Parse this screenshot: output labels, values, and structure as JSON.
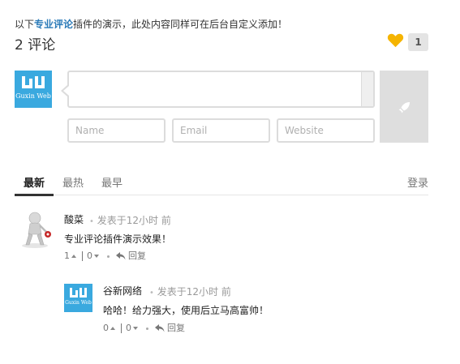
{
  "intro": {
    "prefix": "以下",
    "highlight": "专业评论",
    "suffix": "插件的演示，此处内容同样可在后台自定义添加！"
  },
  "comment_count": "2 评论",
  "like_count": "1",
  "logo_text": "Guxin Web",
  "form": {
    "name_placeholder": "Name",
    "email_placeholder": "Email",
    "website_placeholder": "Website"
  },
  "tabs": [
    "最新",
    "最热",
    "最早"
  ],
  "login_label": "登录",
  "comments": [
    {
      "author": "酸菜",
      "dot": "•",
      "meta": "发表于12小时 前",
      "text": "专业评论插件演示效果！",
      "up": "1",
      "down": "0",
      "reply": "回复"
    },
    {
      "author": "谷新网络",
      "dot": "•",
      "meta": "发表于12小时 前",
      "text": "哈哈！给力强大，使用后立马高富帅！",
      "up": "0",
      "down": "0",
      "reply": "回复"
    }
  ],
  "colors": {
    "accent": "#2a7ab8",
    "heart": "#f5b400",
    "logo": "#3aa9df"
  },
  "icons": [
    "heart-icon",
    "rocket-icon",
    "thumb-up-icon",
    "thumb-down-icon",
    "reply-icon"
  ]
}
